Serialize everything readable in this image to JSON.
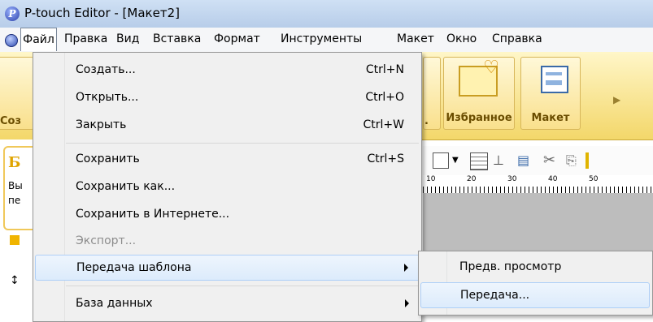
{
  "window": {
    "title": "P-touch Editor - [Макет2]"
  },
  "menubar": {
    "items": [
      "Файл",
      "Правка",
      "Вид",
      "Вставка",
      "Формат",
      "Инструменты",
      "Макет",
      "Окно",
      "Справка"
    ],
    "active_index": 0
  },
  "ribbon": {
    "partial_left_label": "Соз",
    "partial_mid_label": ".",
    "favorites_label": "Избранное",
    "layout_label": "Макет"
  },
  "left_panel": {
    "note_title_partial": "Б",
    "note_line1_partial": "Вы",
    "note_line2_partial": "пе"
  },
  "ruler": {
    "labels": [
      "10",
      "20",
      "30",
      "40",
      "50"
    ]
  },
  "file_menu": {
    "items": [
      {
        "label": "Создать...",
        "shortcut": "Ctrl+N"
      },
      {
        "label": "Открыть...",
        "shortcut": "Ctrl+O"
      },
      {
        "label": "Закрыть",
        "shortcut": "Ctrl+W"
      },
      {
        "label": "Сохранить",
        "shortcut": "Ctrl+S"
      },
      {
        "label": "Сохранить как...",
        "shortcut": ""
      },
      {
        "label": "Сохранить в Интернете...",
        "shortcut": ""
      },
      {
        "label": "Экспорт...",
        "shortcut": "",
        "disabled": true
      },
      {
        "label": "Передача шаблона",
        "shortcut": "",
        "submenu": true,
        "highlighted": true
      },
      {
        "label": "База данных",
        "shortcut": "",
        "submenu": true
      }
    ]
  },
  "transfer_submenu": {
    "items": [
      {
        "label": "Предв. просмотр"
      },
      {
        "label": "Передача...",
        "highlighted": true
      }
    ]
  },
  "colors": {
    "ribbon_accent": "#f3d76a",
    "menu_highlight": "#dcebfc",
    "title_bar": "#c4d7ef"
  }
}
